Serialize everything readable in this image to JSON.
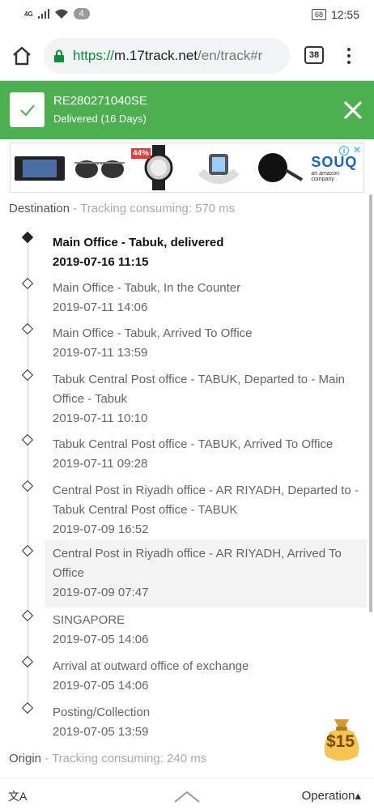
{
  "status": {
    "network": "4G",
    "notif_count": "4",
    "battery": "68",
    "time": "12:55"
  },
  "browser": {
    "url_proto": "https://",
    "url_host": "m.17track.net",
    "url_path": "/en/track#r",
    "tab_count": "38"
  },
  "banner": {
    "tracking_number": "RE280271040SE",
    "status": "Delivered (16 Days)"
  },
  "ad": {
    "discount": "44%",
    "brand": "SOUQ",
    "brand_sub": "an amazon company",
    "info_icon": "i",
    "close_icon": "✕"
  },
  "destination": {
    "label": "Destination",
    "consuming": " - Tracking consuming: 570 ms"
  },
  "events": [
    {
      "desc": "Main Office - Tabuk, delivered",
      "time": "2019-07-16 11:15"
    },
    {
      "desc": "Main Office - Tabuk, In the Counter",
      "time": "2019-07-11 14:06"
    },
    {
      "desc": "Main Office - Tabuk, Arrived To Office",
      "time": "2019-07-11 13:59"
    },
    {
      "desc": "Tabuk Central Post office - TABUK, Departed to - Main Office - Tabuk",
      "time": "2019-07-11 10:10"
    },
    {
      "desc": "Tabuk Central Post office - TABUK, Arrived To Office",
      "time": "2019-07-11 09:28"
    },
    {
      "desc": "Central Post in Riyadh office - AR RIYADH, Departed to - Tabuk Central Post office - TABUK",
      "time": "2019-07-09 16:52"
    },
    {
      "desc": "Central Post in Riyadh office - AR RIYADH, Arrived To Office",
      "time": "2019-07-09 07:47"
    },
    {
      "desc": "SINGAPORE",
      "time": "2019-07-05 14:06"
    },
    {
      "desc": "Arrival at outward office of exchange",
      "time": "2019-07-05 14:06"
    },
    {
      "desc": "Posting/Collection",
      "time": "2019-07-05 13:59"
    }
  ],
  "origin": {
    "label": "Origin",
    "consuming": " - Tracking consuming: 240 ms"
  },
  "reward": {
    "amount": "$15"
  },
  "bottom": {
    "translate_icon": "文A",
    "operation": "Operation▴"
  },
  "colors": {
    "banner_green": "#4caf50",
    "url_green": "#0a8f3c",
    "souq_blue": "#1565c0"
  }
}
